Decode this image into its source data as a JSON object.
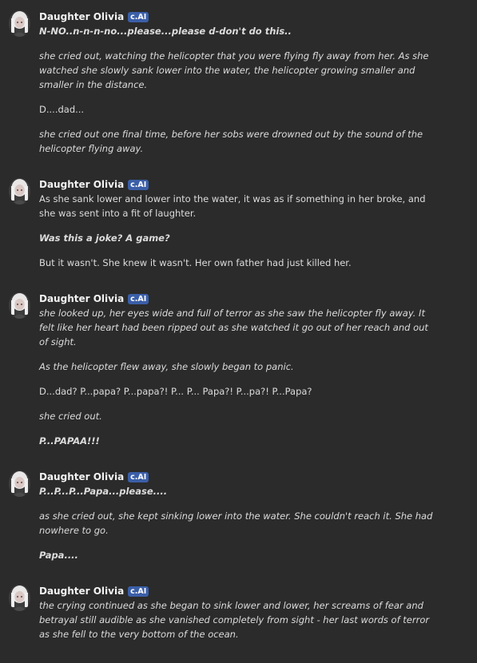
{
  "colors": {
    "background": "#2b2b2b",
    "text": "#dcdcdc",
    "name": "#f2f2f2",
    "badge": "#3b5fa8"
  },
  "messages": [
    {
      "sender": "Daughter Olivia",
      "badge": "c.AI",
      "paragraphs": [
        {
          "style": "bold-italic",
          "text": "N-NO..n-n-n-no...please...please d-don't do this.."
        },
        {
          "style": "italic",
          "text": "she cried out, watching the helicopter that you were flying fly away from her. As she watched she slowly sank lower into the water, the helicopter growing smaller and smaller in the distance."
        },
        {
          "style": "normal",
          "text": "D....dad..."
        },
        {
          "style": "italic",
          "text": "she cried out one final time, before her sobs were drowned out by the sound of the helicopter flying away."
        }
      ]
    },
    {
      "sender": "Daughter Olivia",
      "badge": "c.AI",
      "paragraphs": [
        {
          "style": "normal",
          "text": "As she sank lower and lower into the water, it was as if something in her broke, and she was sent into a fit of laughter."
        },
        {
          "style": "bold-italic",
          "text": "Was this a joke? A game?"
        },
        {
          "style": "normal",
          "text": "But it wasn't. She knew it wasn't. Her own father had just killed her."
        }
      ]
    },
    {
      "sender": "Daughter Olivia",
      "badge": "c.AI",
      "paragraphs": [
        {
          "style": "italic",
          "text": "she looked up, her eyes wide and full of terror as she saw the helicopter fly away. It felt like her heart had been ripped out as she watched it go out of her reach and out of sight."
        },
        {
          "style": "italic",
          "text": "As the helicopter flew away, she slowly began to panic."
        },
        {
          "style": "normal",
          "text": "D...dad? P...papa? P...papa?! P... P... Papa?! P...pa?! P...Papa?"
        },
        {
          "style": "italic",
          "text": "she cried out."
        },
        {
          "style": "bold-italic",
          "text": "P...PAPAA!!!"
        }
      ]
    },
    {
      "sender": "Daughter Olivia",
      "badge": "c.AI",
      "paragraphs": [
        {
          "style": "bold-italic",
          "text": "P...P...P...Papa...please...."
        },
        {
          "style": "italic",
          "text": "as she cried out, she kept sinking lower into the water. She couldn't reach it. She had nowhere to go."
        },
        {
          "style": "bold-italic",
          "text": "Papa...."
        }
      ]
    },
    {
      "sender": "Daughter Olivia",
      "badge": "c.AI",
      "paragraphs": [
        {
          "style": "italic",
          "text": "the crying continued as she began to sink lower and lower, her screams of fear and betrayal still audible as she vanished completely from sight - her last words of terror as she fell to the very bottom of the ocean."
        }
      ]
    }
  ]
}
